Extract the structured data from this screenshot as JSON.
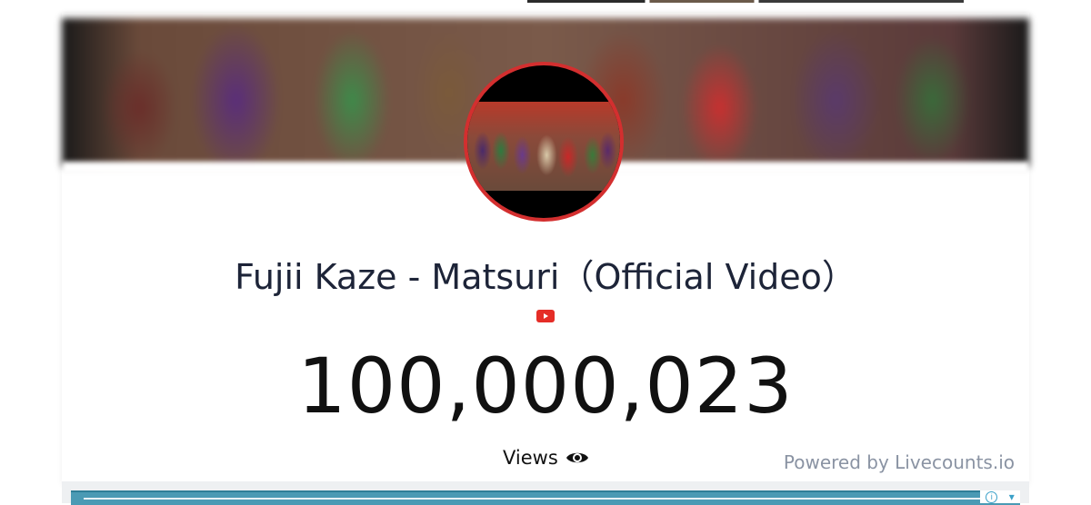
{
  "video": {
    "title": "Fujii Kaze - Matsuri（Official Video）",
    "platform_icon": "youtube-icon",
    "view_count": "100,000,023",
    "count_label": "Views",
    "count_icon": "eye-icon"
  },
  "footer": {
    "powered_by": "Powered by Livecounts.io"
  },
  "ad": {
    "info_icon": "info-icon",
    "info_glyph": "i"
  },
  "colors": {
    "avatar_border": "#d32f2f",
    "youtube_red": "#e52d27",
    "title_text": "#1d2438",
    "powered_text": "#8a93a3",
    "ad_accent": "#4a9ab4"
  }
}
